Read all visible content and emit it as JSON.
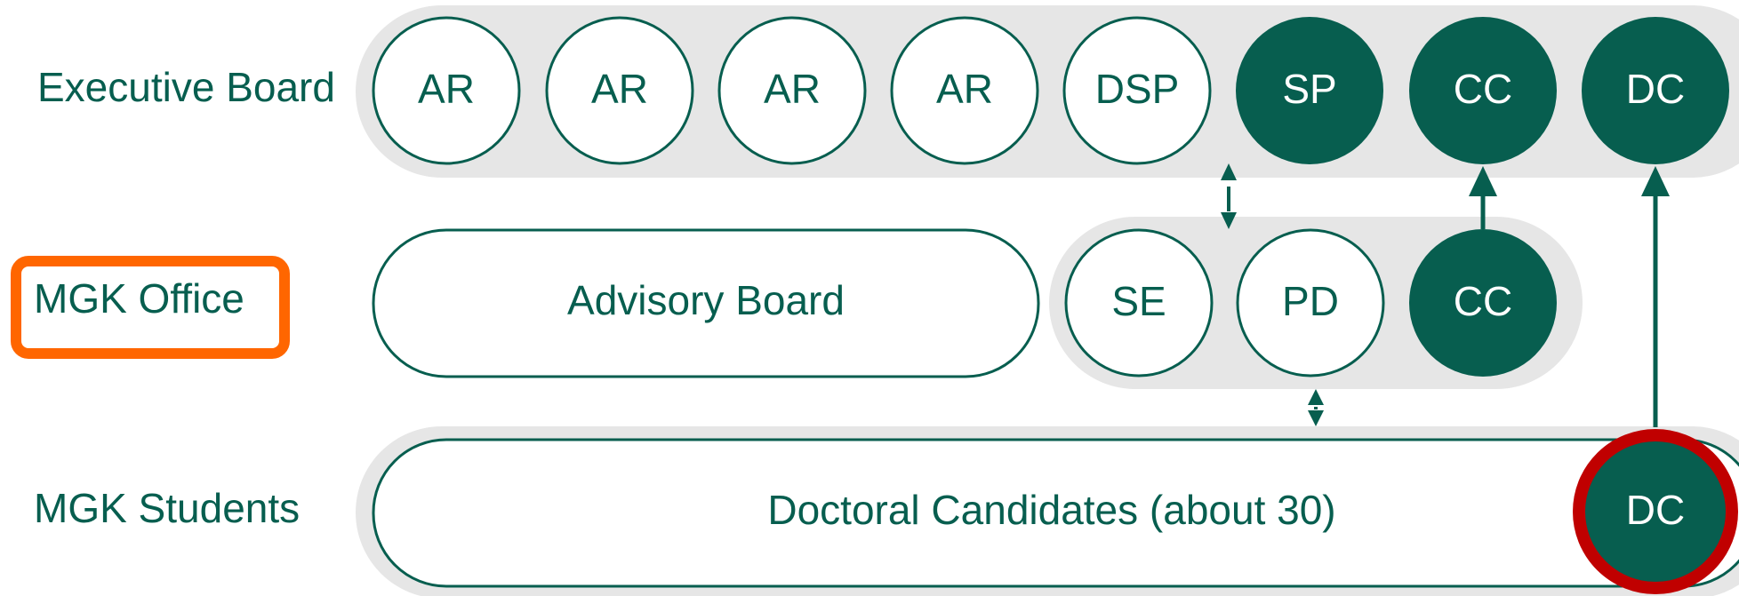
{
  "colors": {
    "green": "#075e4f",
    "band": "#e6e6e6",
    "white": "#ffffff",
    "highlight_orange": "#ff6600",
    "highlight_red": "#c00000"
  },
  "rows": [
    {
      "label": "Executive Board"
    },
    {
      "label": "MGK Office",
      "highlighted": true
    },
    {
      "label": "MGK Students"
    }
  ],
  "executive_board": {
    "members": [
      {
        "label": "AR",
        "filled": false
      },
      {
        "label": "AR",
        "filled": false
      },
      {
        "label": "AR",
        "filled": false
      },
      {
        "label": "AR",
        "filled": false
      },
      {
        "label": "DSP",
        "filled": false
      },
      {
        "label": "SP",
        "filled": true
      },
      {
        "label": "CC",
        "filled": true
      },
      {
        "label": "DC",
        "filled": true
      }
    ]
  },
  "office": {
    "advisory_board": "Advisory Board",
    "members": [
      {
        "label": "SE",
        "filled": false
      },
      {
        "label": "PD",
        "filled": false
      },
      {
        "label": "CC",
        "filled": true
      }
    ]
  },
  "students": {
    "group": "Doctoral Candidates (about 30)",
    "representative": {
      "label": "DC",
      "filled": true,
      "highlighted": true
    }
  }
}
